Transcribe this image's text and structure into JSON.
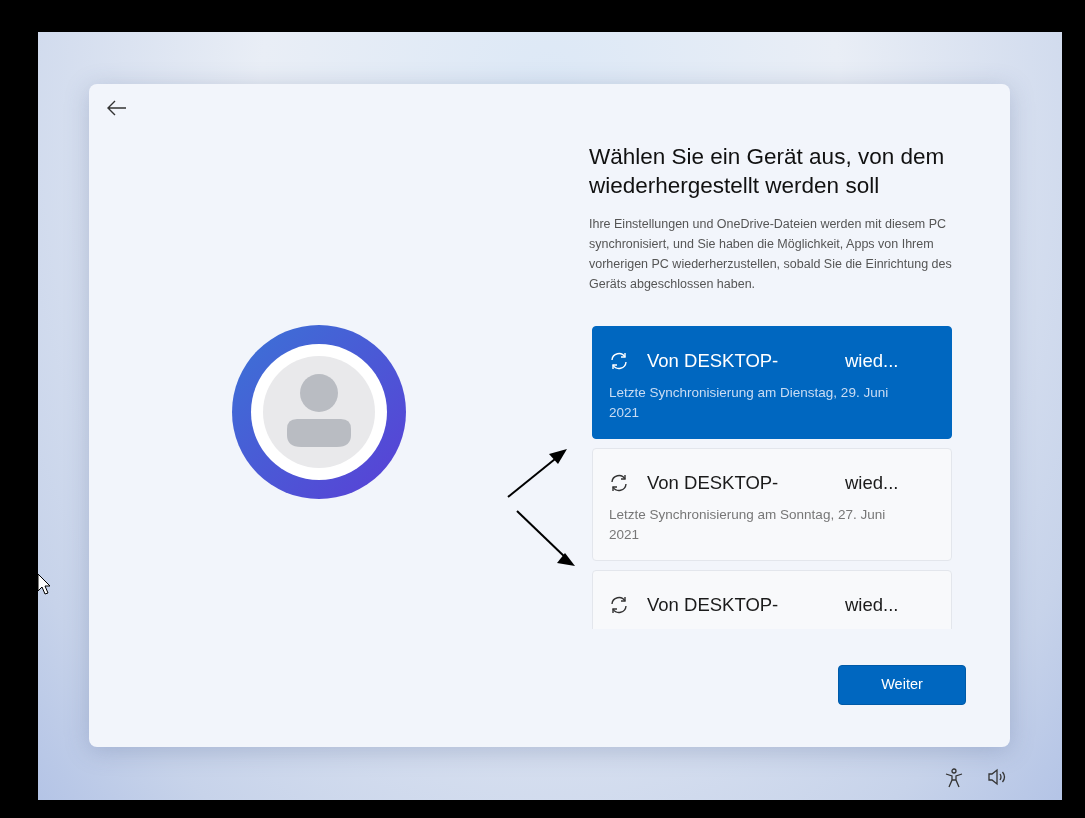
{
  "title": "Wählen Sie ein Gerät aus, von dem wiederhergestellt werden soll",
  "description": "Ihre Einstellungen und OneDrive-Dateien werden mit diesem PC synchronisiert, und Sie haben die Möglichkeit, Apps von Ihrem vorherigen PC wiederherzustellen, sobald Sie die Einrichtung des Geräts abgeschlossen haben.",
  "devices": [
    {
      "name_start": "Von DESKTOP-",
      "name_end": "wied...",
      "last_sync": "Letzte Synchronisierung am Dienstag, 29. Juni 2021",
      "selected": true
    },
    {
      "name_start": "Von DESKTOP-",
      "name_end": "wied...",
      "last_sync": "Letzte Synchronisierung am Sonntag, 27. Juni 2021",
      "selected": false
    },
    {
      "name_start": "Von DESKTOP-",
      "name_end": "wied...",
      "selected": false
    }
  ],
  "next_button": "Weiter"
}
